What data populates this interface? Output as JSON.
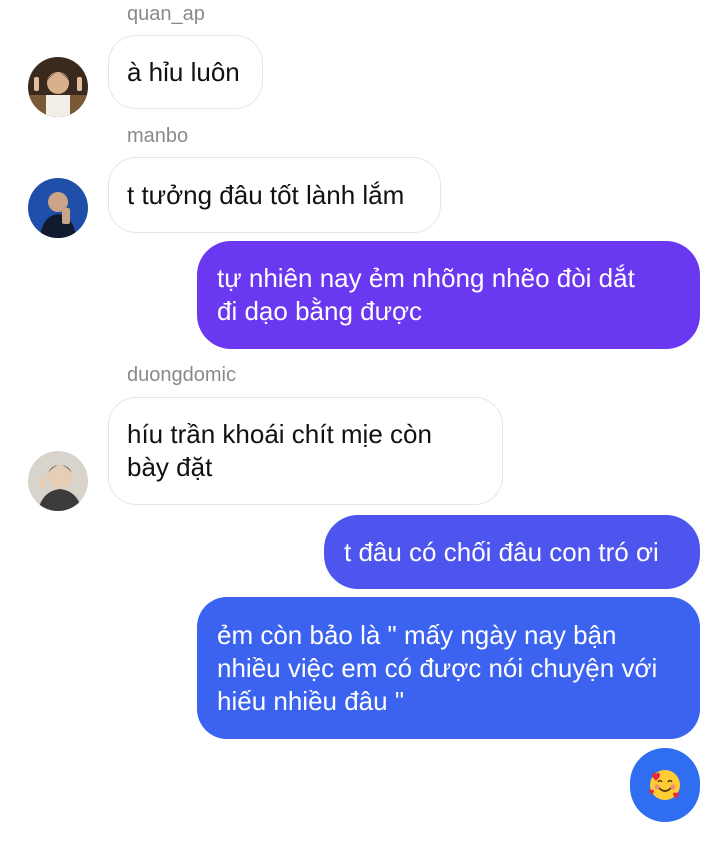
{
  "colors": {
    "outgoing_purple": "#6a38f0",
    "outgoing_blue": "#3b63ef",
    "incoming_bg": "#ffffff",
    "sender_name": "#8a8a8a"
  },
  "messages": [
    {
      "sender": "quan_ap",
      "text": "à hỉu luôn",
      "direction": "incoming"
    },
    {
      "sender": "manbo",
      "text": "t tưởng đâu tốt lành lắm",
      "direction": "incoming"
    },
    {
      "text": "tự nhiên nay ẻm nhõng nhẽo đòi dắt\nđi dạo bằng được",
      "direction": "outgoing"
    },
    {
      "sender": "duongdomic",
      "text": "híu trần khoái chít mịe còn\nbày đặt",
      "direction": "incoming"
    },
    {
      "text": "t đâu có chối đâu con tró ơi",
      "direction": "outgoing"
    },
    {
      "text": "ẻm còn bảo là \" mấy ngày nay bận\nnhiều việc em có được nói chuyện với\nhiếu nhiều đâu \"",
      "direction": "outgoing"
    },
    {
      "emoji": "smiling-face-with-hearts-icon",
      "direction": "outgoing"
    }
  ]
}
